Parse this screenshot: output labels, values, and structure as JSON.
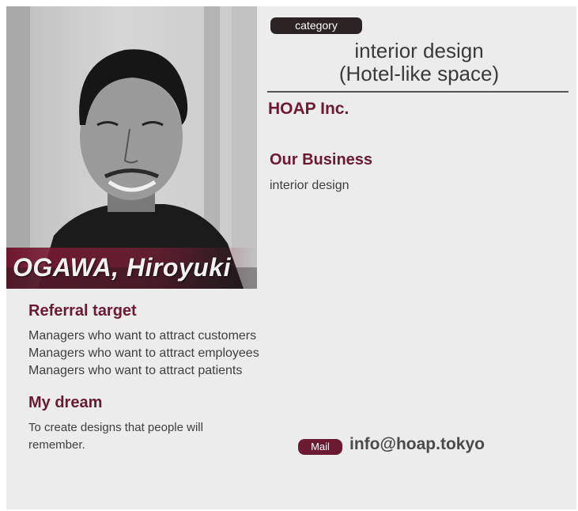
{
  "profile": {
    "name": "OGAWA, Hiroyuki",
    "category_label": "category",
    "headline_line1": "interior design",
    "headline_line2": "(Hotel-like space)",
    "company": "HOAP Inc."
  },
  "business": {
    "title": "Our Business",
    "text": "interior design"
  },
  "referral": {
    "title": "Referral target",
    "items": [
      "Managers who want to attract customers",
      "Managers who want to attract employees",
      "Managers who want to attract patients"
    ]
  },
  "dream": {
    "title": "My dream",
    "line1": "To create designs that people will",
    "line2": "remember."
  },
  "contact": {
    "mail_label": "Mail",
    "email": "info@hoap.tokyo"
  },
  "colors": {
    "accent": "#6b1a31",
    "badge_dark": "#2c2424",
    "card_bg": "#ececec"
  }
}
